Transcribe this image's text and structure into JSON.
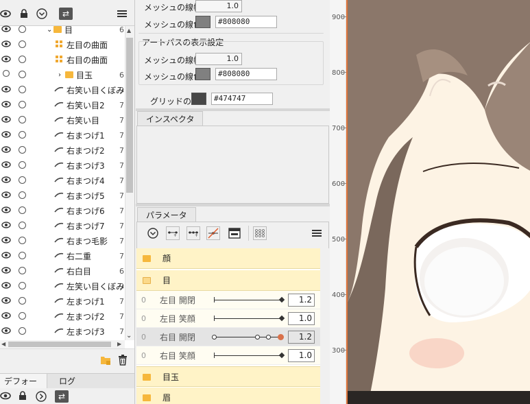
{
  "left_toolbar": {
    "icons": [
      "eye-icon",
      "lock-icon",
      "chevron-circle-icon",
      "swap-icon",
      "menu-icon"
    ]
  },
  "tree": {
    "rows": [
      {
        "label": "目",
        "num": "6",
        "kind": "folder",
        "indent": 80
      },
      {
        "label": "左目の曲面",
        "num": "",
        "kind": "warp",
        "indent": 97
      },
      {
        "label": "右目の曲面",
        "num": "",
        "kind": "warp",
        "indent": 97
      },
      {
        "label": "目玉",
        "num": "6",
        "kind": "folder",
        "indent": 97
      },
      {
        "label": "右笑い目くぼみ",
        "num": "9",
        "kind": "art",
        "indent": 97
      },
      {
        "label": "右笑い目2",
        "num": "7",
        "kind": "art",
        "indent": 97
      },
      {
        "label": "右笑い目",
        "num": "7",
        "kind": "art",
        "indent": 97
      },
      {
        "label": "右まつげ1",
        "num": "7",
        "kind": "art",
        "indent": 97
      },
      {
        "label": "右まつげ2",
        "num": "7",
        "kind": "art",
        "indent": 97
      },
      {
        "label": "右まつげ3",
        "num": "7",
        "kind": "art",
        "indent": 97
      },
      {
        "label": "右まつげ4",
        "num": "7",
        "kind": "art",
        "indent": 97
      },
      {
        "label": "右まつげ5",
        "num": "7",
        "kind": "art",
        "indent": 97
      },
      {
        "label": "右まつげ6",
        "num": "7",
        "kind": "art",
        "indent": 97
      },
      {
        "label": "右まつげ7",
        "num": "7",
        "kind": "art",
        "indent": 97
      },
      {
        "label": "右まつ毛影",
        "num": "7",
        "kind": "art",
        "indent": 97
      },
      {
        "label": "右二重",
        "num": "7",
        "kind": "art",
        "indent": 97
      },
      {
        "label": "右白目",
        "num": "6",
        "kind": "art",
        "indent": 97
      },
      {
        "label": "左笑い目くぼみ",
        "num": "9",
        "kind": "art",
        "indent": 97
      },
      {
        "label": "左まつげ1",
        "num": "7",
        "kind": "art",
        "indent": 97
      },
      {
        "label": "左まつげ2",
        "num": "7",
        "kind": "art",
        "indent": 97
      },
      {
        "label": "左まつげ3",
        "num": "7",
        "kind": "art",
        "indent": 97
      }
    ]
  },
  "left_bottom": {
    "icons": [
      "new-folder-icon",
      "trash-icon"
    ]
  },
  "deformer_tabs": {
    "tab1": "デフォーマ",
    "tab2": "ログ"
  },
  "mesh_settings": {
    "width_label": "メッシュの線幅",
    "width_value": "1.0",
    "color_label": "メッシュの線色",
    "color_value": "#808080"
  },
  "artpath_settings": {
    "title": "アートパスの表示設定",
    "width_label": "メッシュの線幅",
    "width_value": "1.0",
    "color_label": "メッシュの線色",
    "color_value": "#808080"
  },
  "grid": {
    "label": "グリッドの色",
    "color_value": "#474747"
  },
  "inspector": {
    "tab": "インスペクタ"
  },
  "parameters": {
    "tab": "パラメータ",
    "toolbar_icons": [
      "chevron-circle-icon",
      "add-key-icon",
      "add-keys-icon",
      "remove-key-icon",
      "key-table-icon",
      "key-grid-icon",
      "menu-icon"
    ],
    "rows": [
      {
        "type": "group",
        "label": "顔",
        "open": false
      },
      {
        "type": "group",
        "label": "目",
        "open": true
      },
      {
        "type": "param",
        "zero": "0",
        "name": "左目 開閉",
        "value": "1.2",
        "selected": false
      },
      {
        "type": "param",
        "zero": "0",
        "name": "左目 笑顔",
        "value": "1.0",
        "selected": false
      },
      {
        "type": "param",
        "zero": "0",
        "name": "右目 開閉",
        "value": "1.2",
        "selected": true
      },
      {
        "type": "param",
        "zero": "0",
        "name": "右目 笑顔",
        "value": "1.0",
        "selected": false
      },
      {
        "type": "group",
        "label": "目玉",
        "open": false
      },
      {
        "type": "group",
        "label": "眉",
        "open": false
      }
    ]
  },
  "ruler": {
    "ticks": [
      "900",
      "800",
      "700",
      "600",
      "500",
      "400",
      "300"
    ]
  },
  "colors": {
    "mesh": "#808080",
    "grid": "#474747",
    "accent": "#e0743a",
    "group_bg": "#fff3c7",
    "folder": "#f6b73c"
  }
}
